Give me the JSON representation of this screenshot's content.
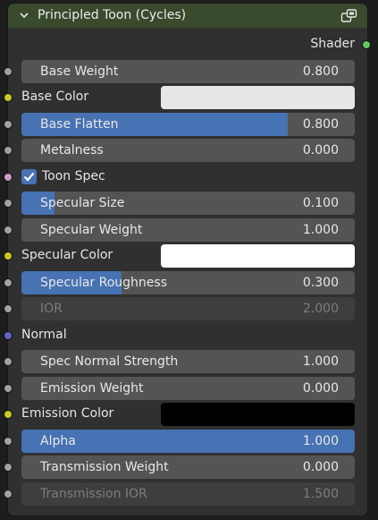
{
  "node": {
    "title": "Principled Toon (Cycles)",
    "output": "Shader"
  },
  "rows": {
    "base_weight": {
      "label": "Base Weight",
      "value": "0.800"
    },
    "base_color": {
      "label": "Base Color",
      "color": "#e6e6e6"
    },
    "base_flatten": {
      "label": "Base Flatten",
      "value": "0.800"
    },
    "metalness": {
      "label": "Metalness",
      "value": "0.000"
    },
    "toon_spec": {
      "label": "Toon Spec",
      "checked": true
    },
    "specular_size": {
      "label": "Specular Size",
      "value": "0.100"
    },
    "specular_weight": {
      "label": "Specular Weight",
      "value": "1.000"
    },
    "specular_color": {
      "label": "Specular Color",
      "color": "#ffffff"
    },
    "specular_roughness": {
      "label": "Specular Roughness",
      "value": "0.300"
    },
    "ior": {
      "label": "IOR",
      "value": "2.000"
    },
    "normal": {
      "label": "Normal"
    },
    "spec_normal_strength": {
      "label": "Spec Normal Strength",
      "value": "1.000"
    },
    "emission_weight": {
      "label": "Emission Weight",
      "value": "0.000"
    },
    "emission_color": {
      "label": "Emission Color",
      "color": "#000000"
    },
    "alpha": {
      "label": "Alpha",
      "value": "1.000"
    },
    "transmission_weight": {
      "label": "Transmission Weight",
      "value": "0.000"
    },
    "transmission_ior": {
      "label": "Transmission IOR",
      "value": "1.500"
    }
  },
  "colors": {
    "header": "#3a4a2d",
    "slider_fill": "#4772b3",
    "socket_float": "#a1a1a1",
    "socket_color": "#c7c729",
    "socket_bool": "#cc9dc6",
    "socket_vector": "#6363c7",
    "socket_shader": "#63c763"
  },
  "icons": {
    "collapse": "chevron-down-icon",
    "node_type": "node-group-icon"
  }
}
